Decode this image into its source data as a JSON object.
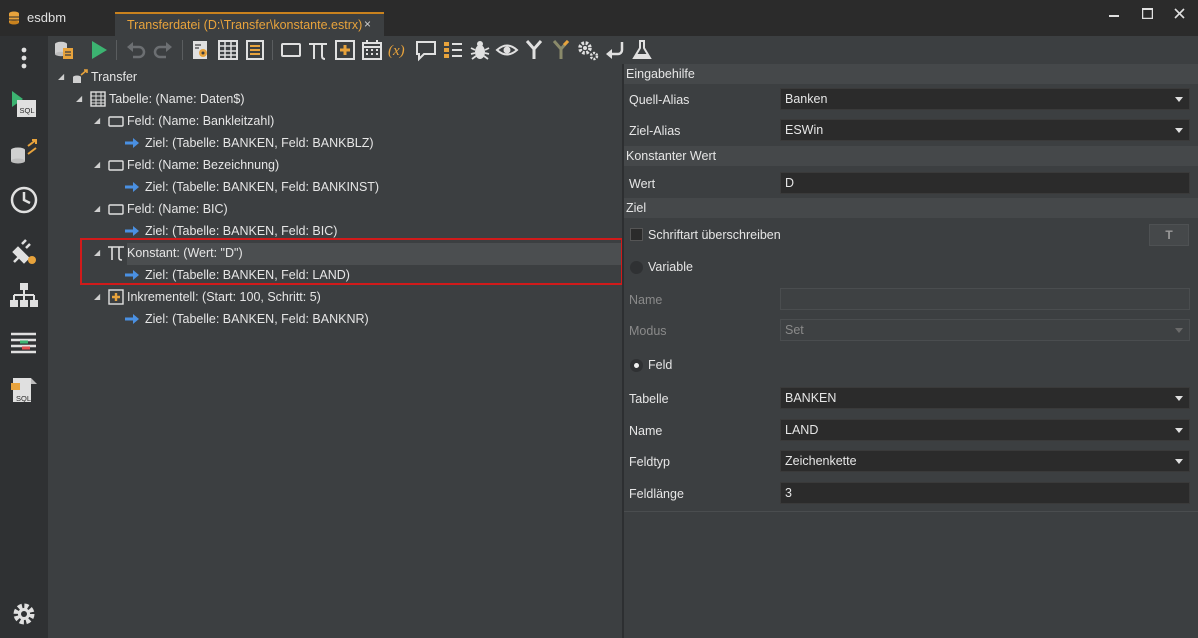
{
  "app": {
    "title": "esdbm"
  },
  "tab": {
    "label": "Transferdatei (D:\\Transfer\\konstante.estrx)",
    "close": "×"
  },
  "window": {
    "minimize": "▬",
    "maximize": "☐",
    "close": "✕"
  },
  "sidebar": {
    "items": [
      {
        "icon": "more-vertical-icon"
      },
      {
        "icon": "sql-query-icon"
      },
      {
        "icon": "database-transfer-icon"
      },
      {
        "icon": "history-clock-icon"
      },
      {
        "icon": "plugin-settings-icon"
      },
      {
        "icon": "hierarchy-tree-icon"
      },
      {
        "icon": "compare-list-icon"
      },
      {
        "icon": "sql-file-icon"
      },
      {
        "icon": "settings-gear-icon"
      }
    ]
  },
  "toolbar": {
    "icons": [
      "database-icon",
      "run-icon",
      "undo-icon",
      "redo-icon",
      "table-settings-icon",
      "table-icon",
      "list-icon",
      "field-icon",
      "pi-constant-icon",
      "increment-icon",
      "calendar-icon",
      "variable-icon",
      "comment-icon",
      "list-check-icon",
      "bug-icon",
      "eye-icon",
      "merge-icon",
      "split-icon",
      "gears-icon",
      "return-icon",
      "flask-icon"
    ]
  },
  "tree": {
    "root": "Transfer",
    "table": "Tabelle: (Name: Daten$)",
    "nodes": [
      {
        "label": "Feld: (Name: Bankleitzahl)",
        "target": "Ziel: (Tabelle: BANKEN, Feld: BANKBLZ)"
      },
      {
        "label": "Feld: (Name: Bezeichnung)",
        "target": "Ziel: (Tabelle: BANKEN, Feld: BANKINST)"
      },
      {
        "label": "Feld: (Name: BIC)",
        "target": "Ziel: (Tabelle: BANKEN, Feld: BIC)"
      },
      {
        "label": "Konstant: (Wert: \"D\")",
        "target": "Ziel: (Tabelle: BANKEN, Feld: LAND)"
      },
      {
        "label": "Inkrementell: (Start: 100, Schritt: 5)",
        "target": "Ziel: (Tabelle: BANKEN, Feld: BANKNR)"
      }
    ]
  },
  "props": {
    "section_eingabehilfe": "Eingabehilfe",
    "quell_alias_label": "Quell-Alias",
    "quell_alias_value": "Banken",
    "ziel_alias_label": "Ziel-Alias",
    "ziel_alias_value": "ESWin",
    "section_konstant": "Konstanter Wert",
    "wert_label": "Wert",
    "wert_value": "D",
    "section_ziel": "Ziel",
    "schriftart_label": "Schriftart überschreiben",
    "font_button": "T",
    "variable_label": "Variable",
    "name_label": "Name",
    "name_value": "",
    "modus_label": "Modus",
    "modus_value": "Set",
    "feld_label": "Feld",
    "tabelle_label": "Tabelle",
    "tabelle_value": "BANKEN",
    "feldname_label": "Name",
    "feldname_value": "LAND",
    "feldtyp_label": "Feldtyp",
    "feldtyp_value": "Zeichenkette",
    "feldlaenge_label": "Feldlänge",
    "feldlaenge_value": "3"
  },
  "colors": {
    "accent": "#e8a33c",
    "highlight_border": "#d11a1a",
    "run_green": "#3cb371",
    "arrow_blue": "#4a90e2"
  }
}
